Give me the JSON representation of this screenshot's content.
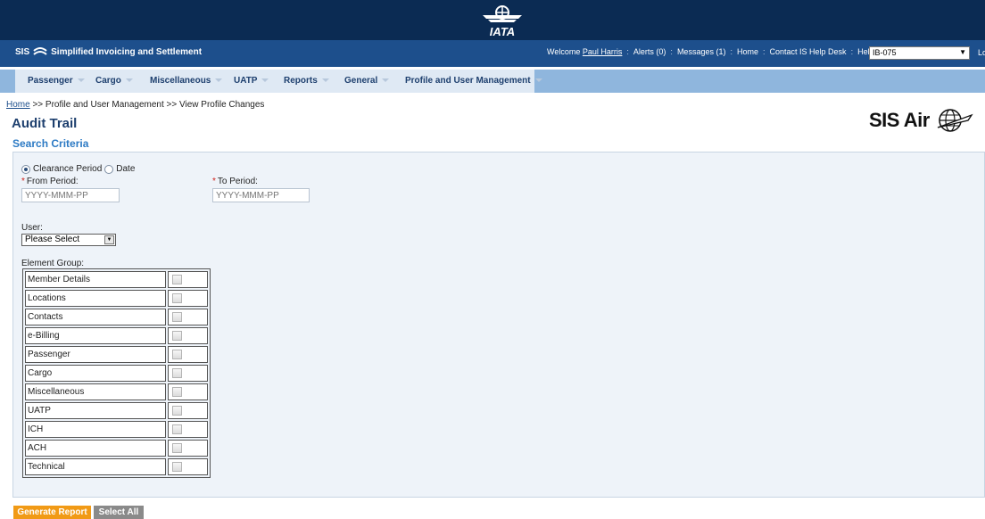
{
  "header": {
    "logo_text": "IATA",
    "app_prefix": "SIS",
    "app_title": "Simplified Invoicing and Settlement",
    "welcome_prefix": "Welcome",
    "user_name": "Paul Harris",
    "links": [
      "Alerts (0)",
      "Messages (1)",
      "Home",
      "Contact IS Help Desk",
      "Help"
    ],
    "member_selected": "IB-075",
    "logout_label": "Log O"
  },
  "menu": {
    "items": [
      "Passenger",
      "Cargo",
      "Miscellaneous",
      "UATP",
      "Reports",
      "General",
      "Profile and User Management"
    ]
  },
  "breadcrumb": {
    "home": "Home",
    "rest": " >> Profile and User Management >> View Profile Changes"
  },
  "page": {
    "title": "Audit Trail",
    "section_title": "Search Criteria",
    "brand": "SIS Air"
  },
  "form": {
    "radio_options": [
      "Clearance Period",
      "Date"
    ],
    "radio_selected": "Clearance Period",
    "from_label": "From Period:",
    "from_placeholder": "YYYY-MMM-PP",
    "to_label": "To Period:",
    "to_placeholder": "YYYY-MMM-PP",
    "user_label": "User:",
    "user_selected": "Please Select",
    "element_group_label": "Element Group:",
    "element_groups": [
      "Member Details",
      "Locations",
      "Contacts",
      "e-Billing",
      "Passenger",
      "Cargo",
      "Miscellaneous",
      "UATP",
      "ICH",
      "ACH",
      "Technical"
    ]
  },
  "buttons": {
    "generate": "Generate Report",
    "select_all": "Select All"
  },
  "colors": {
    "header_dark": "#0b2b53",
    "header_blue": "#1d4f8c",
    "menu_bg": "#8fb6dd",
    "accent_orange": "#f19a16"
  }
}
